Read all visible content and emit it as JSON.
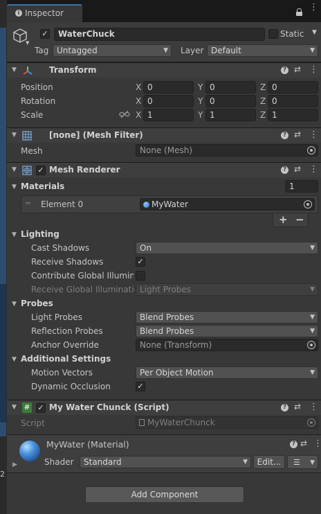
{
  "tab": {
    "title": "Inspector",
    "lock_icon": "lock-icon",
    "menu_icon": "kebab-menu-icon"
  },
  "gameobject": {
    "name": "WaterChuck",
    "active": true,
    "static_label": "Static",
    "static_checked": false,
    "tag_label": "Tag",
    "tag_value": "Untagged",
    "layer_label": "Layer",
    "layer_value": "Default"
  },
  "transform": {
    "title": "Transform",
    "position": {
      "label": "Position",
      "x": "0",
      "y": "0",
      "z": "0"
    },
    "rotation": {
      "label": "Rotation",
      "x": "0",
      "y": "0",
      "z": "0"
    },
    "scale": {
      "label": "Scale",
      "x": "1",
      "y": "1",
      "z": "1"
    },
    "axis_x": "X",
    "axis_y": "Y",
    "axis_z": "Z"
  },
  "mesh_filter": {
    "title": "[none] (Mesh Filter)",
    "mesh_label": "Mesh",
    "mesh_value": "None (Mesh)"
  },
  "mesh_renderer": {
    "title": "Mesh Renderer",
    "enabled": true,
    "materials_label": "Materials",
    "materials_count": "1",
    "element0_label": "Element 0",
    "element0_value": "MyWater",
    "add_label": "+",
    "remove_label": "−",
    "lighting_label": "Lighting",
    "cast_shadows_label": "Cast Shadows",
    "cast_shadows_value": "On",
    "receive_shadows_label": "Receive Shadows",
    "receive_shadows_checked": true,
    "contribute_gi_label": "Contribute Global Illuminat",
    "contribute_gi_checked": false,
    "receive_gi_label": "Receive Global Illuminatior",
    "receive_gi_value": "Light Probes",
    "probes_label": "Probes",
    "light_probes_label": "Light Probes",
    "light_probes_value": "Blend Probes",
    "reflection_probes_label": "Reflection Probes",
    "reflection_probes_value": "Blend Probes",
    "anchor_override_label": "Anchor Override",
    "anchor_override_value": "None (Transform)",
    "additional_label": "Additional Settings",
    "motion_vectors_label": "Motion Vectors",
    "motion_vectors_value": "Per Object Motion",
    "dynamic_occlusion_label": "Dynamic Occlusion",
    "dynamic_occlusion_checked": true
  },
  "script_component": {
    "title": "My Water Chunck (Script)",
    "enabled": true,
    "script_label": "Script",
    "script_value": "MyWaterChunck"
  },
  "material": {
    "title": "MyWater (Material)",
    "shader_label": "Shader",
    "shader_value": "Standard",
    "edit_label": "Edit...",
    "left_edge_number": "2"
  },
  "add_component_label": "Add Component",
  "colors": {
    "background": "#191919",
    "panel": "#383838",
    "header": "#3e3e3e",
    "field": "#2a2a2a",
    "dropdown": "#515151",
    "material_sphere": "#3a7bd5"
  }
}
